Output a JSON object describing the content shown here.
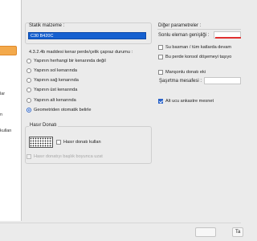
{
  "left_panel": {
    "items": [
      "lar",
      "n",
      "kullan"
    ]
  },
  "material": {
    "title": "Statik malzeme :",
    "selected": "C30 B420C"
  },
  "clause": {
    "title": "4.3.2.4b maddesi kenar perde/çelik çapraz durumu :",
    "options": [
      {
        "label": "Yapının herhangi bir kenarında değil",
        "selected": false
      },
      {
        "label": "Yapının sol kenarında",
        "selected": false
      },
      {
        "label": "Yapının sağ kenarında",
        "selected": false
      },
      {
        "label": "Yapının üst kenarında",
        "selected": false
      },
      {
        "label": "Yapının alt kenarında",
        "selected": false
      },
      {
        "label": "Geometriden otomatik belirle",
        "selected": true
      }
    ]
  },
  "hasir": {
    "title": "Hasır Donatı",
    "use_label": "Hasır donatı kullan",
    "extend_label": "Hasır donatıyı başlık boyunca uzat"
  },
  "other": {
    "title": "Diğer parametreler :",
    "element_width_label": "Sonlu eleman genişliği :",
    "checks": [
      {
        "label": "Su basman / tüm katlarda devam",
        "checked": false
      },
      {
        "label": "Bu perde konsol döşemeyi taşıyo",
        "checked": false
      },
      {
        "label": "Manşonlu donatı eki",
        "checked": false
      }
    ],
    "sasirtma_label": "Şaşırtma mesafesi :",
    "alt_mesnet": {
      "label": "Alt ucu ankastre mesnet",
      "checked": true
    }
  },
  "footer": {
    "tamam_label": "Ta"
  },
  "colors": {
    "accent": "#2a63c9",
    "selection": "#1560d0",
    "highlight": "#f3a94b",
    "red_underline": "#e03030"
  }
}
